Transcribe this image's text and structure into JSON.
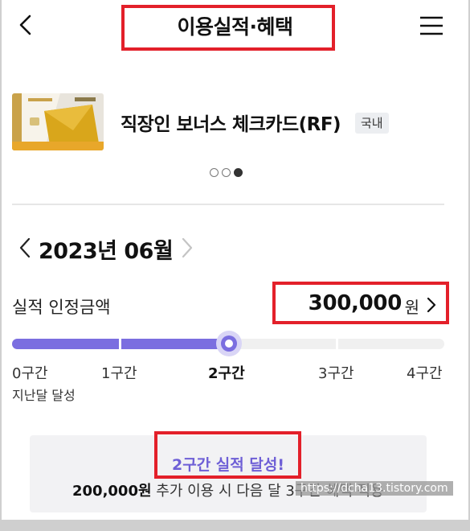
{
  "header": {
    "title": "이용실적·혜택",
    "back_icon": "chevron-left-icon",
    "menu_icon": "hamburger-menu-icon"
  },
  "card": {
    "name": "직장인 보너스 체크카드(RF)",
    "badge": "국내",
    "carousel_dots": 3,
    "active_dot": 3
  },
  "month_selector": {
    "label": "2023년 06월"
  },
  "performance": {
    "label": "실적 인정금액",
    "amount": "300,000",
    "unit": "원"
  },
  "tiers": {
    "items": [
      "0구간",
      "1구간",
      "2구간",
      "3구간",
      "4구간"
    ],
    "current_index": 2,
    "sub_label": "지난달 달성"
  },
  "info": {
    "title": "2구간 실적 달성!",
    "desc_amount": "200,000원",
    "desc_text": " 추가 이용 시 다음 달 3구간 혜택 적용"
  },
  "watermark": "https://dcha13.tistory.com",
  "colors": {
    "accent": "#7b6ee0",
    "highlight_border": "#e3202a",
    "info_bg": "#f2f2f4"
  }
}
